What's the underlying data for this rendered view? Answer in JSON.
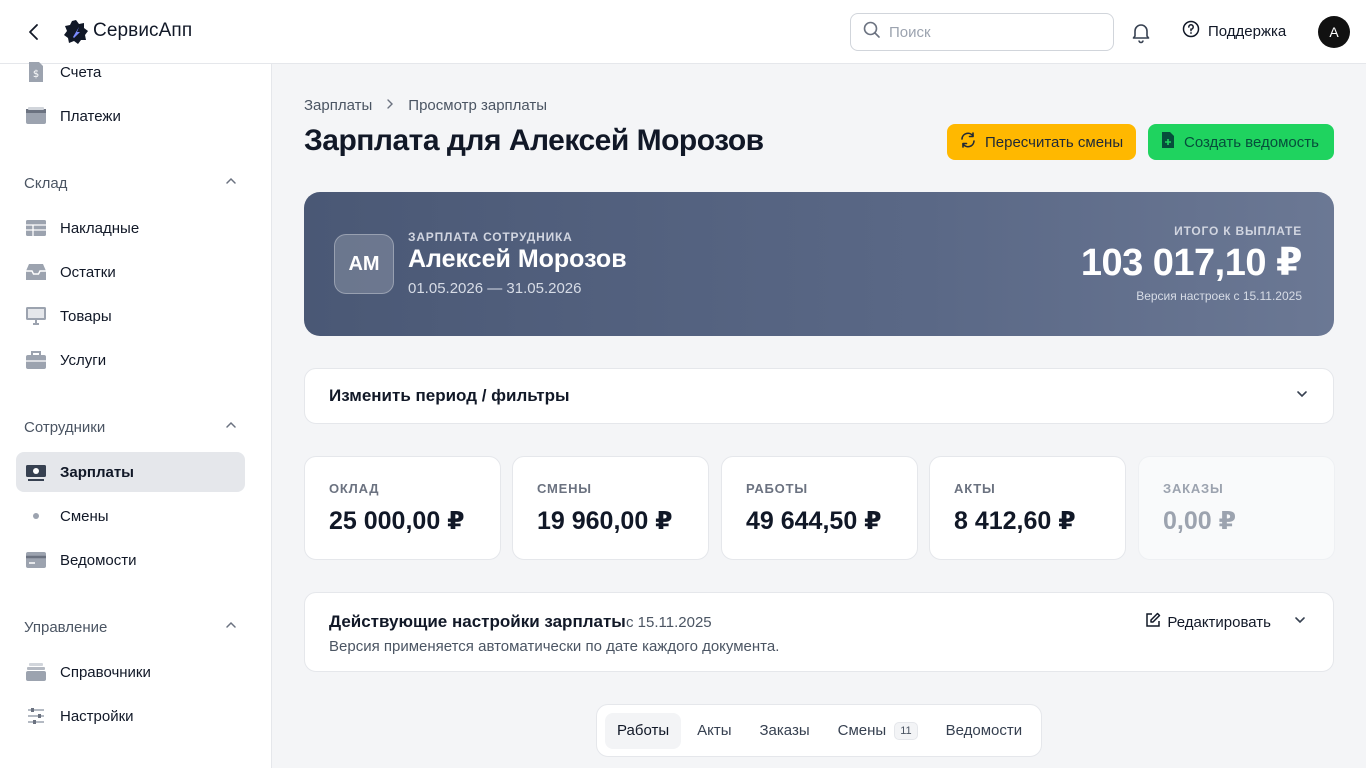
{
  "header": {
    "app_name": "СервисАпп",
    "search_placeholder": "Поиск",
    "support_label": "Поддержка",
    "avatar_initial": "A"
  },
  "sidebar": {
    "top_items": [
      {
        "label": "Счета",
        "icon": "invoice-icon"
      },
      {
        "label": "Платежи",
        "icon": "payments-icon"
      }
    ],
    "sections": [
      {
        "title": "Склад",
        "items": [
          {
            "label": "Накладные",
            "icon": "table-icon"
          },
          {
            "label": "Остатки",
            "icon": "inbox-icon"
          },
          {
            "label": "Товары",
            "icon": "monitor-icon"
          },
          {
            "label": "Услуги",
            "icon": "briefcase-icon"
          }
        ]
      },
      {
        "title": "Сотрудники",
        "items": [
          {
            "label": "Зарплаты",
            "icon": "banknote-icon",
            "active": true
          },
          {
            "label": "Смены",
            "icon": "dot-icon"
          },
          {
            "label": "Ведомости",
            "icon": "card-icon"
          }
        ]
      },
      {
        "title": "Управление",
        "items": [
          {
            "label": "Справочники",
            "icon": "stack-icon"
          },
          {
            "label": "Настройки",
            "icon": "sliders-icon"
          }
        ]
      }
    ]
  },
  "breadcrumb": {
    "root": "Зарплаты",
    "current": "Просмотр зарплаты"
  },
  "page": {
    "title": "Зарплата для Алексей Морозов",
    "recalc_button": "Пересчитать смены",
    "create_button": "Создать ведомость"
  },
  "hero": {
    "initials": "АМ",
    "label": "ЗАРПЛАТА СОТРУДНИКА",
    "name": "Алексей Морозов",
    "period": "01.05.2026 — 31.05.2026",
    "total_label": "ИТОГО К ВЫПЛАТЕ",
    "total": "103 017,10 ₽",
    "version": "Версия настроек с 15.11.2025"
  },
  "filters": {
    "label": "Изменить период / фильтры"
  },
  "stats": [
    {
      "label": "ОКЛАД",
      "value": "25 000,00 ₽"
    },
    {
      "label": "СМЕНЫ",
      "value": "19 960,00 ₽"
    },
    {
      "label": "РАБОТЫ",
      "value": "49 644,50 ₽"
    },
    {
      "label": "АКТЫ",
      "value": "8 412,60 ₽"
    },
    {
      "label": "ЗАКАЗЫ",
      "value": "0,00 ₽",
      "muted": true
    }
  ],
  "settings": {
    "title": "Действующие настройки зарплаты",
    "since": "с 15.11.2025",
    "note": "Версия применяется автоматически по дате каждого документа.",
    "edit_label": "Редактировать"
  },
  "tabs": [
    {
      "label": "Работы",
      "active": true
    },
    {
      "label": "Акты"
    },
    {
      "label": "Заказы"
    },
    {
      "label": "Смены",
      "badge": "11"
    },
    {
      "label": "Ведомости"
    }
  ]
}
